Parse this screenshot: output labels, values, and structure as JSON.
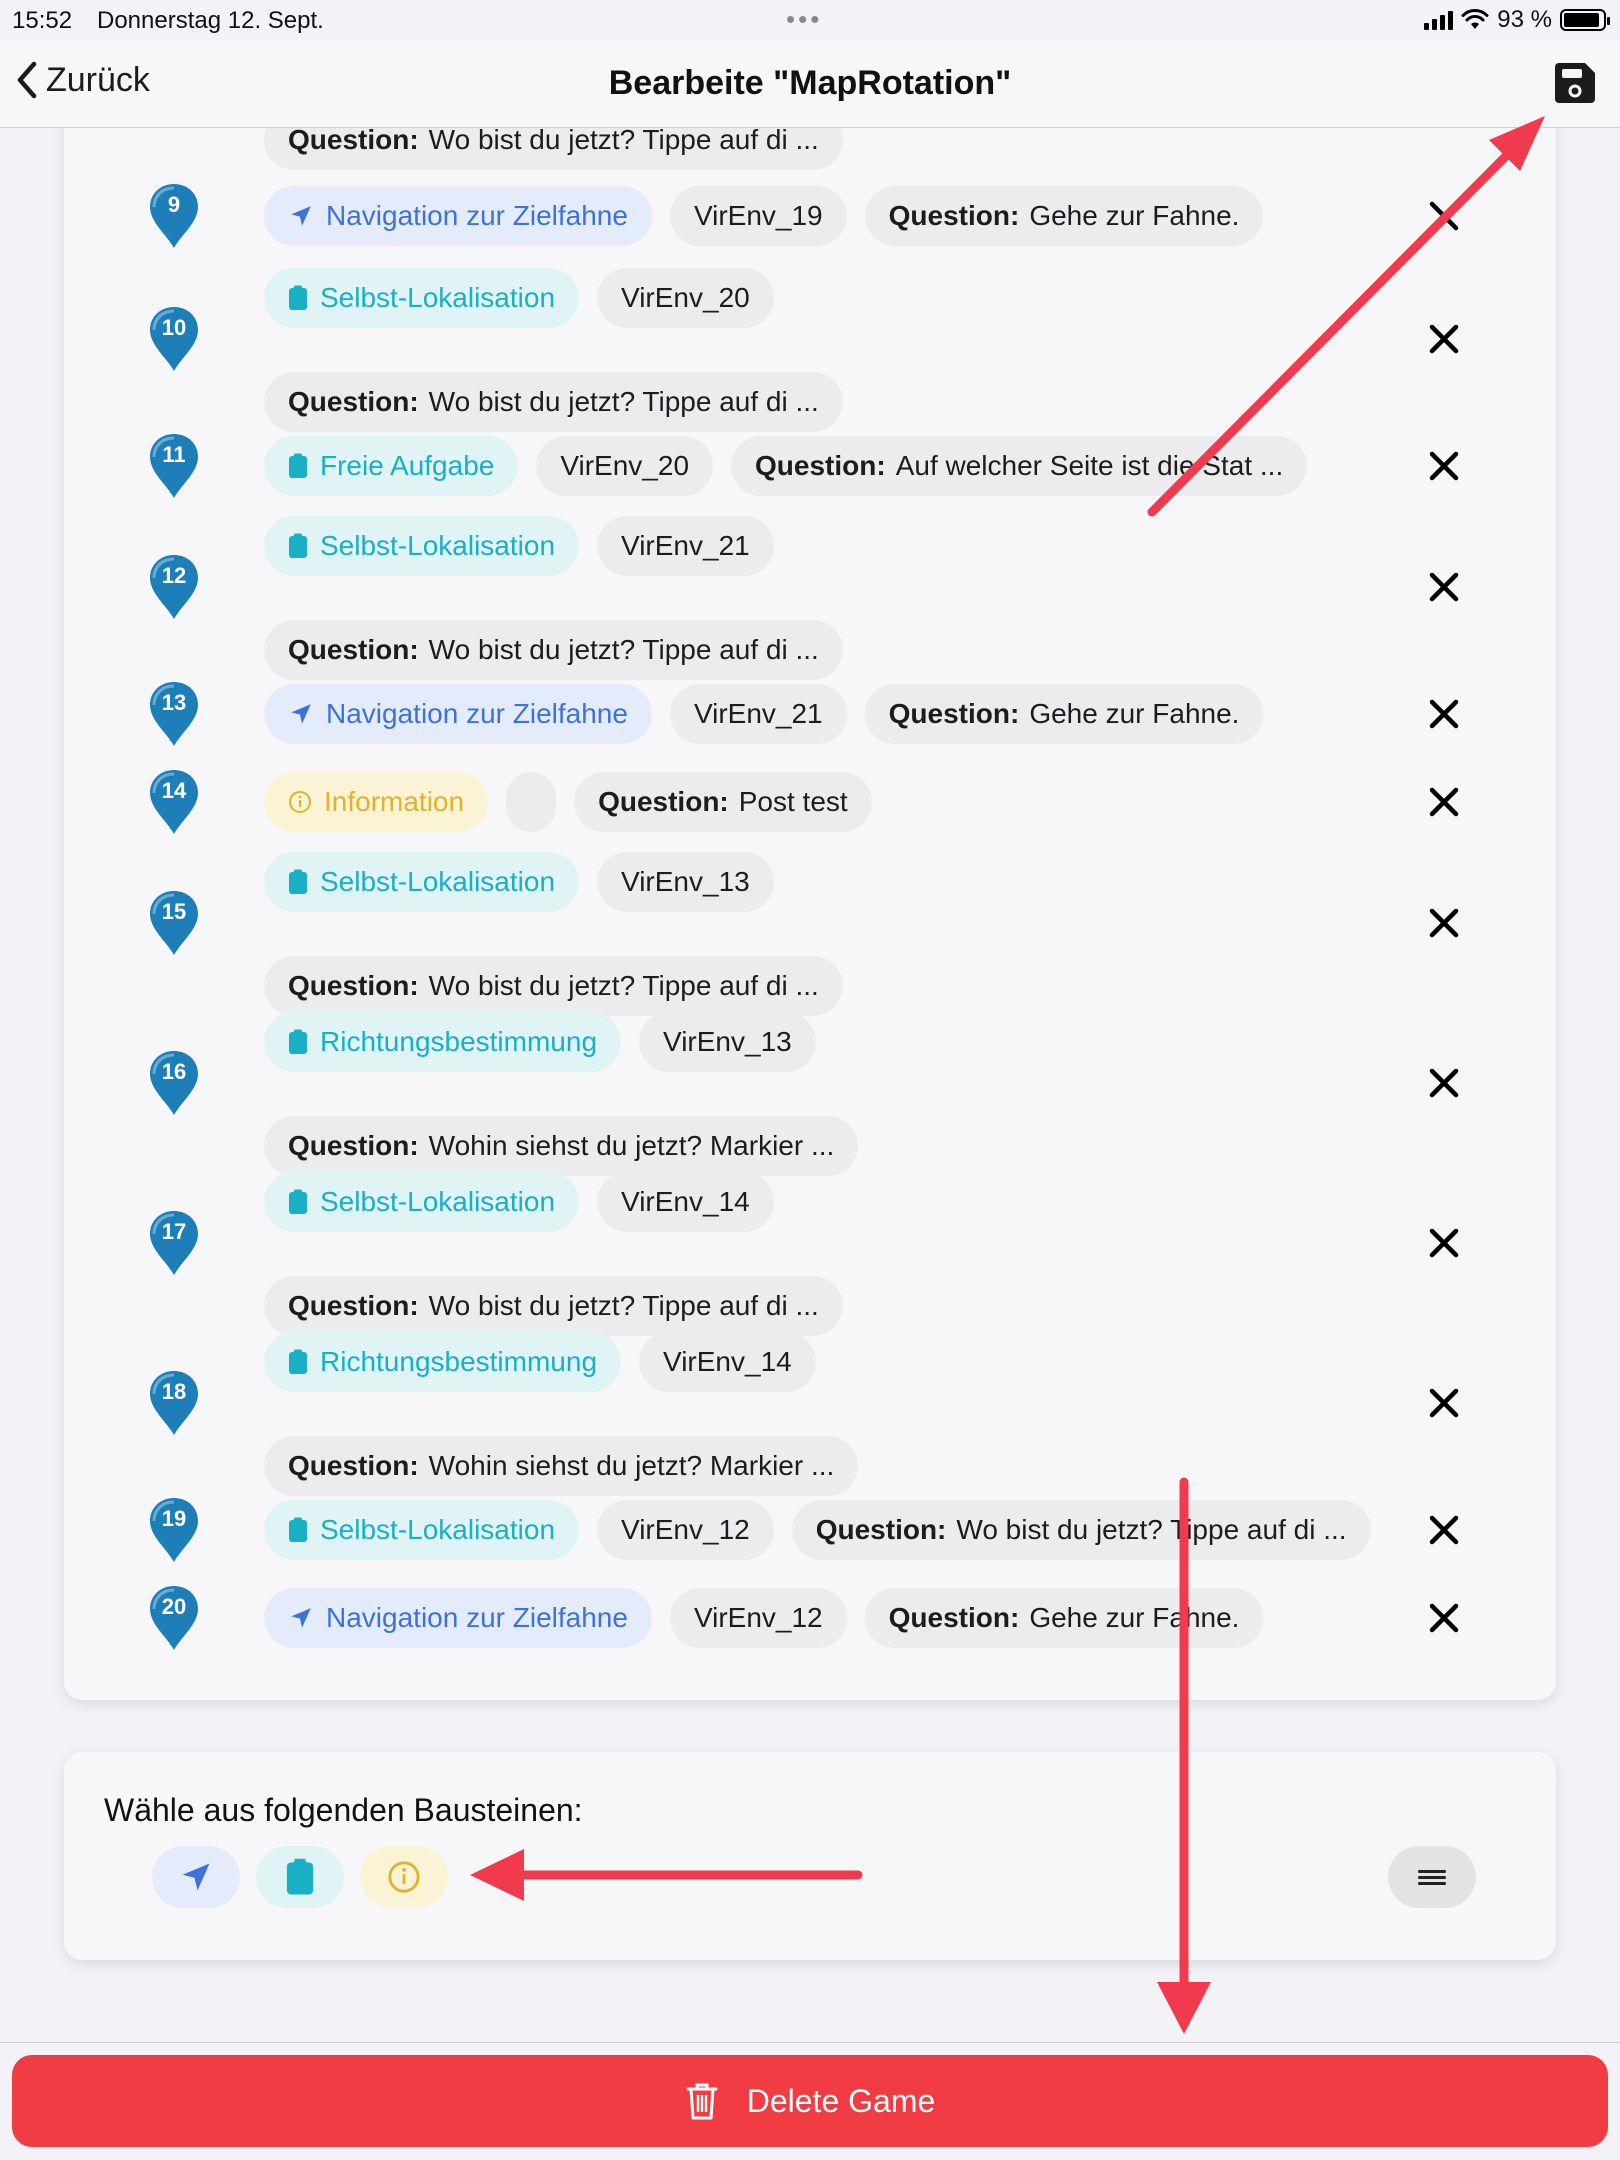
{
  "status_bar": {
    "time": "15:52",
    "date": "Donnerstag 12. Sept.",
    "battery": "93 %"
  },
  "nav": {
    "back_label": "Zurück",
    "title": "Bearbeite \"MapRotation\""
  },
  "colors": {
    "marker": "#1e7fb8",
    "nav_type": "#3d73d8",
    "task_type": "#19b0c6",
    "info_type": "#e0b32b",
    "delete": "#f23c43",
    "annotation_arrow": "#f23a4e"
  },
  "question_prefix": "Question:",
  "partial_row": {
    "question": "Wo bist du jetzt? Tippe auf di ..."
  },
  "steps": [
    {
      "number": "9",
      "type": "nav",
      "type_label": "Navigation zur Zielfahne",
      "env": "VirEnv_19",
      "question": "Gehe zur Fahne."
    },
    {
      "number": "10",
      "type": "task",
      "type_label": "Selbst-Lokalisation",
      "env": "VirEnv_20",
      "question": "Wo bist du jetzt? Tippe auf di ..."
    },
    {
      "number": "11",
      "type": "task",
      "type_label": "Freie Aufgabe",
      "env": "VirEnv_20",
      "question": "Auf welcher Seite ist die Stat ..."
    },
    {
      "number": "12",
      "type": "task",
      "type_label": "Selbst-Lokalisation",
      "env": "VirEnv_21",
      "question": "Wo bist du jetzt? Tippe auf di ..."
    },
    {
      "number": "13",
      "type": "nav",
      "type_label": "Navigation zur Zielfahne",
      "env": "VirEnv_21",
      "question": "Gehe zur Fahne."
    },
    {
      "number": "14",
      "type": "info",
      "type_label": "Information",
      "env": "",
      "question": "Post test"
    },
    {
      "number": "15",
      "type": "task",
      "type_label": "Selbst-Lokalisation",
      "env": "VirEnv_13",
      "question": "Wo bist du jetzt? Tippe auf di ..."
    },
    {
      "number": "16",
      "type": "task",
      "type_label": "Richtungsbestimmung",
      "env": "VirEnv_13",
      "question": "Wohin siehst du jetzt? Markier ..."
    },
    {
      "number": "17",
      "type": "task",
      "type_label": "Selbst-Lokalisation",
      "env": "VirEnv_14",
      "question": "Wo bist du jetzt? Tippe auf di ..."
    },
    {
      "number": "18",
      "type": "task",
      "type_label": "Richtungsbestimmung",
      "env": "VirEnv_14",
      "question": "Wohin siehst du jetzt? Markier ..."
    },
    {
      "number": "19",
      "type": "task",
      "type_label": "Selbst-Lokalisation",
      "env": "VirEnv_12",
      "question": "Wo bist du jetzt? Tippe auf di ..."
    },
    {
      "number": "20",
      "type": "nav",
      "type_label": "Navigation zur Zielfahne",
      "env": "VirEnv_12",
      "question": "Gehe zur Fahne."
    }
  ],
  "palette": {
    "title": "Wähle aus folgenden Bausteinen:",
    "buttons": [
      {
        "type": "nav",
        "icon": "navigation-arrow-icon"
      },
      {
        "type": "task",
        "icon": "clipboard-icon"
      },
      {
        "type": "info",
        "icon": "info-circle-icon"
      }
    ],
    "menu_icon": "hamburger-icon"
  },
  "delete_button": {
    "label": "Delete Game",
    "icon": "trash-icon"
  }
}
